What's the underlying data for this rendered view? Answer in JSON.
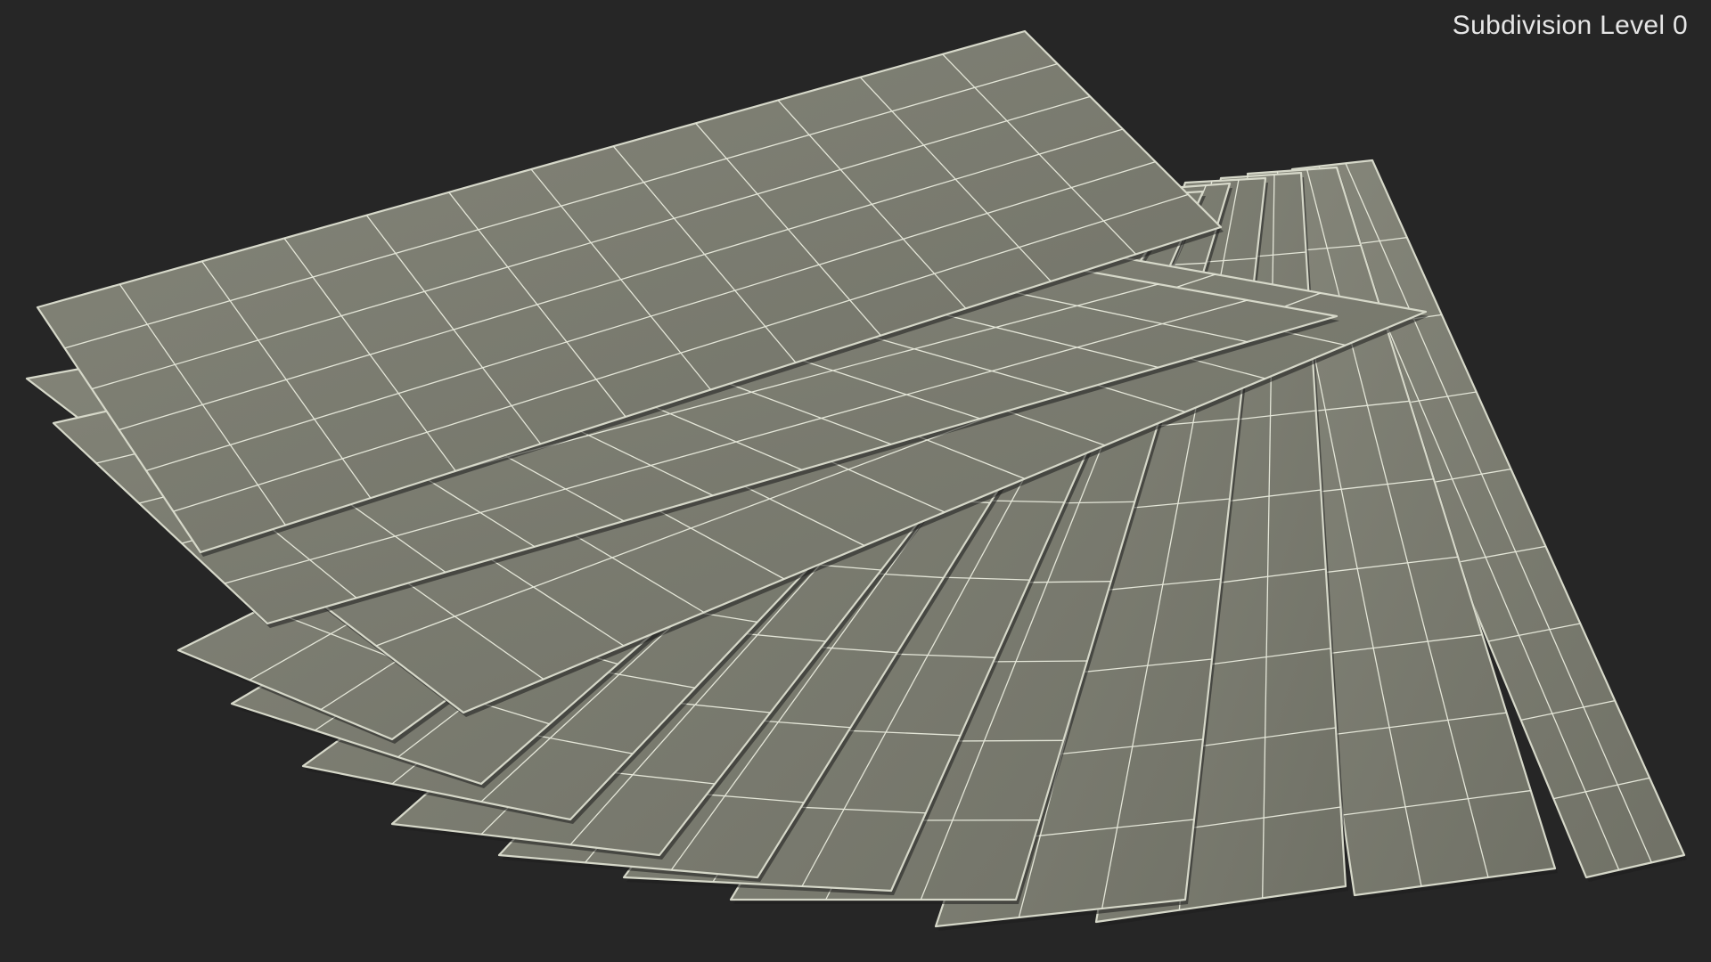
{
  "viewport": {
    "label": "Subdivision Level 0",
    "background_color": "#262626",
    "surface_color": "#7b7c70",
    "edge_color": "#d6d8c9",
    "wire_color": "#e4e6d8"
  },
  "model": {
    "description_name": "fanned-paper-sheets",
    "sheet_count": 12
  }
}
